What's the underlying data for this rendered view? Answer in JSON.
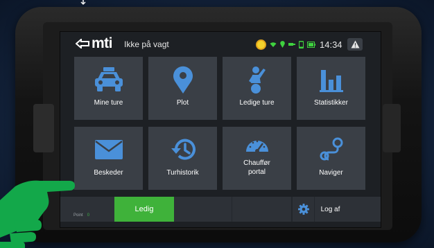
{
  "colors": {
    "tile_bg": "#3a3f46",
    "screen_bg": "#1d2024",
    "accent_blue": "#4a90d9",
    "ledig_green": "#3fb23a",
    "status_green": "#3fd23f",
    "hand_green": "#13a84a"
  },
  "header": {
    "logo": "mti",
    "duty_status": "Ikke på vagt",
    "time": "14:34",
    "status_icons": [
      "sun-icon",
      "wifi-icon",
      "location-pin-icon",
      "plug-icon",
      "phone-icon",
      "battery-icon"
    ],
    "warning_icon": "warning-icon"
  },
  "tiles": [
    {
      "label": "Mine ture",
      "icon": "taxi-icon"
    },
    {
      "label": "Plot",
      "icon": "location-pin-icon"
    },
    {
      "label": "Ledige ture",
      "icon": "hailing-person-icon"
    },
    {
      "label": "Statistikker",
      "icon": "bar-chart-icon"
    },
    {
      "label": "Beskeder",
      "icon": "envelope-icon"
    },
    {
      "label": "Turhistorik",
      "icon": "history-icon"
    },
    {
      "label": "Chauffør\nportal",
      "icon": "speedometer-icon"
    },
    {
      "label": "Naviger",
      "icon": "route-icon"
    }
  ],
  "bottombar": {
    "points_label": "Point",
    "points_value": "0",
    "status_button": "Ledig",
    "settings_icon": "gear-icon",
    "logout": "Log af"
  }
}
